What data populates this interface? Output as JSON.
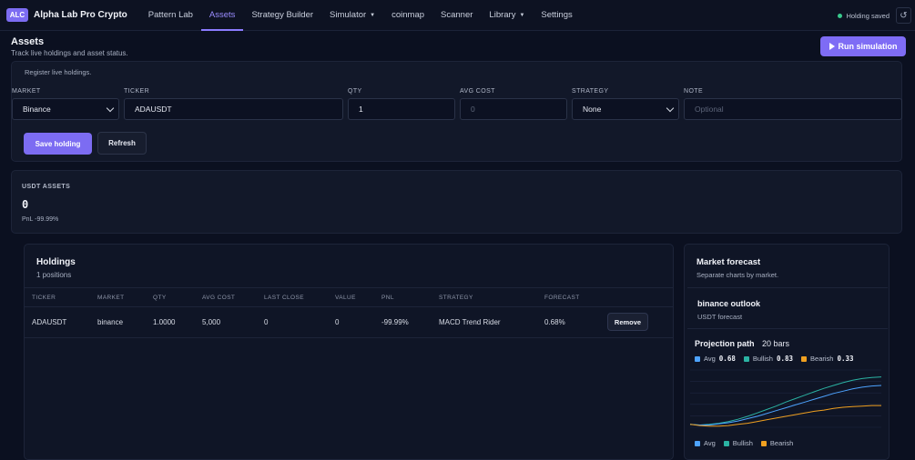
{
  "nav": {
    "logo": "ALC",
    "brand": "Alpha Lab Pro Crypto",
    "links": [
      {
        "label": "Pattern Lab"
      },
      {
        "label": "Assets"
      },
      {
        "label": "Strategy Builder"
      },
      {
        "label": "Simulator"
      },
      {
        "label": "coinmap"
      },
      {
        "label": "Scanner"
      },
      {
        "label": "Library"
      },
      {
        "label": "Settings"
      }
    ],
    "status": "Holding saved",
    "reload_icon": "↺"
  },
  "page": {
    "title": "Assets",
    "subtitle": "Track live holdings and asset status.",
    "run_label": "Run simulation"
  },
  "form": {
    "hint": "Register live holdings.",
    "labels": {
      "market": "MARKET",
      "ticker": "TICKER",
      "qty": "QTY",
      "avg_cost": "AVG COST",
      "strategy": "STRATEGY",
      "note": "NOTE"
    },
    "values": {
      "market": "Binance",
      "ticker": "ADAUSDT",
      "qty": "1",
      "avg_cost_placeholder": "0",
      "strategy": "None",
      "note_placeholder": "Optional"
    },
    "save_label": "Save holding",
    "refresh_label": "Refresh"
  },
  "assets": {
    "label": "USDT ASSETS",
    "value": "0",
    "pnl": "PnL -99.99%"
  },
  "holdings": {
    "title": "Holdings",
    "count": "1 positions",
    "columns": [
      "TICKER",
      "MARKET",
      "QTY",
      "AVG COST",
      "LAST CLOSE",
      "VALUE",
      "PNL",
      "STRATEGY",
      "FORECAST"
    ],
    "rows": [
      {
        "ticker": "ADAUSDT",
        "market": "binance",
        "qty": "1.0000",
        "avg_cost": "5,000",
        "last_close": "0",
        "value": "0",
        "pnl": "-99.99%",
        "strategy": "MACD Trend Rider",
        "forecast": "0.68%",
        "remove_label": "Remove"
      }
    ]
  },
  "forecast": {
    "title": "Market forecast",
    "subtitle": "Separate charts by market.",
    "outlook_title": "binance outlook",
    "outlook_sub": "USDT forecast",
    "projection_label": "Projection path",
    "bars_label": "20 bars",
    "legend": {
      "avg": {
        "name": "Avg",
        "value": "0.68"
      },
      "bullish": {
        "name": "Bullish",
        "value": "0.83"
      },
      "bearish": {
        "name": "Bearish",
        "value": "0.33"
      }
    },
    "colors": {
      "avg": "#4da3ff",
      "bullish": "#2bb3a3",
      "bearish": "#f0a020"
    }
  },
  "chart_data": {
    "type": "line",
    "x": [
      0,
      1,
      2,
      3,
      4,
      5,
      6,
      7,
      8,
      9,
      10,
      11,
      12,
      13,
      14,
      15,
      16,
      17,
      18,
      19,
      20
    ],
    "series": [
      {
        "name": "Bullish",
        "values": [
          0,
          -0.01,
          0,
          0.02,
          0.05,
          0.09,
          0.14,
          0.2,
          0.26,
          0.32,
          0.39,
          0.45,
          0.51,
          0.57,
          0.63,
          0.68,
          0.73,
          0.77,
          0.8,
          0.82,
          0.83
        ]
      },
      {
        "name": "Avg",
        "values": [
          0,
          -0.01,
          -0.01,
          0.01,
          0.03,
          0.06,
          0.1,
          0.14,
          0.19,
          0.24,
          0.29,
          0.34,
          0.39,
          0.44,
          0.49,
          0.54,
          0.58,
          0.62,
          0.65,
          0.67,
          0.68
        ]
      },
      {
        "name": "Bearish",
        "values": [
          0,
          -0.02,
          -0.03,
          -0.03,
          -0.02,
          0,
          0.02,
          0.05,
          0.08,
          0.11,
          0.14,
          0.17,
          0.2,
          0.23,
          0.25,
          0.28,
          0.3,
          0.31,
          0.32,
          0.33,
          0.33
        ]
      }
    ],
    "ylim": [
      -0.05,
      0.95
    ],
    "grid": true
  }
}
